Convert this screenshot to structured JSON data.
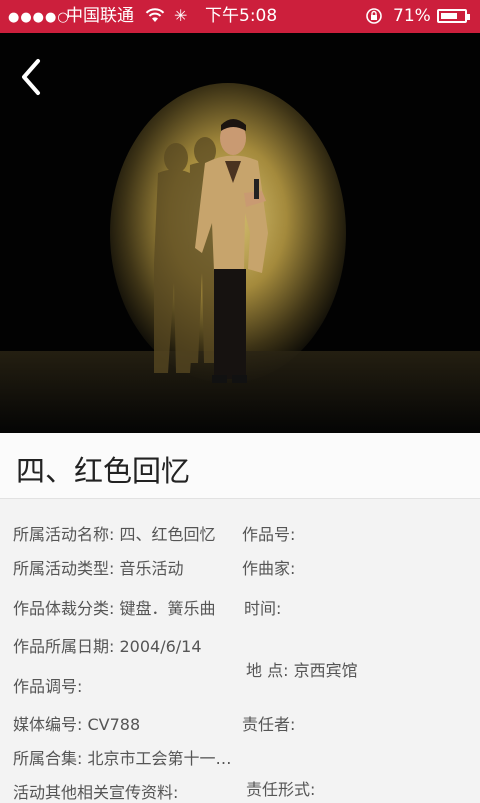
{
  "status_bar": {
    "signal": "●●●●○",
    "carrier": "中国联通",
    "time": "下午5:08",
    "battery": "71%",
    "battery_level": 0.71
  },
  "colors": {
    "accent": "#cc1f3c",
    "title_bg": "#fbfbfb",
    "content_bg": "#f3f3f3"
  },
  "icons": {
    "back": "chevron-left-icon",
    "wifi": "wifi-icon",
    "lock": "rotation-lock-icon",
    "battery": "battery-icon"
  },
  "title": "四、红色回忆",
  "details": {
    "activity_name": "所属活动名称: 四、红色回忆",
    "work_number": "作品号:",
    "activity_type": "所属活动类型: 音乐活动",
    "composer": "作曲家:",
    "genre": "作品体裁分类: 键盘．簧乐曲",
    "time": "时间:",
    "date": "作品所属日期: 2004/6/14",
    "location": "地 点:  京西宾馆",
    "key": "作品调号:",
    "media_id": "媒体编号: CV788",
    "responsible": "责任者:",
    "collection": "所属合集: 北京市工会第十一届职工文化艺术节",
    "other_materials": "活动其他相关宣传资料:",
    "responsibility_form": "责任形式:"
  }
}
